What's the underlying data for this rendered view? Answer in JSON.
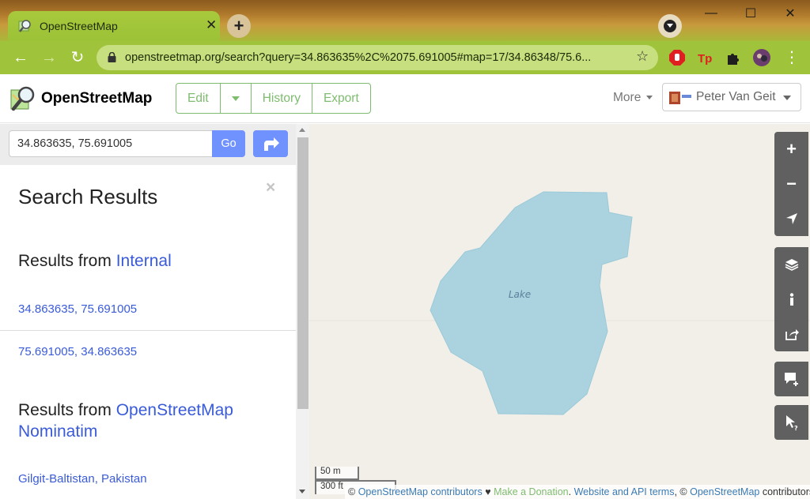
{
  "browser": {
    "tab_title": "OpenStreetMap",
    "tab_close": "✕",
    "new_tab": "+",
    "url": "openstreetmap.org/search?query=34.863635%2C%2075.691005#map=17/34.86348/75.6...",
    "window": {
      "minimize": "—",
      "maximize": "☐",
      "close": "✕"
    }
  },
  "osm": {
    "brand": "OpenStreetMap",
    "edit_label": "Edit",
    "history_label": "History",
    "export_label": "Export",
    "more_label": "More",
    "user_name": "Peter Van Geit"
  },
  "search": {
    "query": "34.863635, 75.691005",
    "go_label": "Go"
  },
  "results": {
    "title": "Search Results",
    "close": "×",
    "internal_prefix": "Results from ",
    "internal_source": "Internal",
    "internal_items": [
      "34.863635, 75.691005",
      "75.691005, 34.863635"
    ],
    "nominatim_prefix": "Results from ",
    "nominatim_source_line1": "OpenStreetMap",
    "nominatim_source_line2": "Nominatim",
    "nominatim_items": [
      "Gilgit-Baltistan, Pakistan"
    ]
  },
  "map": {
    "lake_label": "Lake",
    "scale_metric": "50 m",
    "scale_imperial": "300 ft",
    "attribution": {
      "copy1": "© ",
      "contributors_link": "OpenStreetMap contributors",
      "heart": " ♥ ",
      "donation": "Make a Donation",
      "sep": ". ",
      "api_terms": "Website and API terms",
      "copy2": ", © ",
      "contributors_link2": "OpenStreetMap",
      "tail": " contributors"
    },
    "water_color": "#aad3df",
    "land_color": "#f2efe9"
  },
  "colors": {
    "osm_green": "#7ebc6f",
    "link_blue": "#3a5bd9",
    "go_blue": "#7092ff"
  }
}
